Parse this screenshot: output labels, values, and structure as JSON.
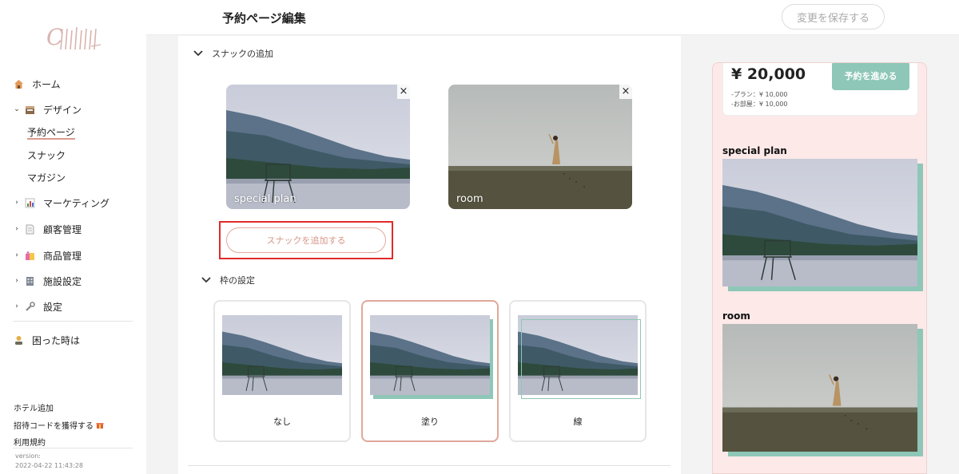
{
  "header": {
    "title": "予約ページ編集",
    "save_label": "変更を保存する"
  },
  "sidebar": {
    "items": [
      {
        "label": "ホーム",
        "icon": "house-icon"
      },
      {
        "label": "デザイン",
        "icon": "design-icon",
        "expanded": true
      },
      {
        "label": "マーケティング",
        "icon": "chart-icon"
      },
      {
        "label": "顧客管理",
        "icon": "document-icon"
      },
      {
        "label": "商品管理",
        "icon": "shopping-bag-icon"
      },
      {
        "label": "施設設定",
        "icon": "building-icon"
      },
      {
        "label": "設定",
        "icon": "wrench-icon"
      }
    ],
    "sub_items": [
      {
        "label": "予約ページ",
        "active": true
      },
      {
        "label": "スナック"
      },
      {
        "label": "マガジン"
      }
    ],
    "help": "困った時は",
    "footer_links": [
      "ホテル追加",
      "招待コードを獲得する",
      "利用規約"
    ],
    "version_label": "version:",
    "version_date": "2022-04-22 11:43:28"
  },
  "snack_section": {
    "title": "スナックの追加",
    "cards": [
      {
        "label": "special plan"
      },
      {
        "label": "room"
      }
    ],
    "add_label": "スナックを追加する"
  },
  "frame_section": {
    "title": "枠の設定",
    "options": [
      {
        "label": "なし"
      },
      {
        "label": "塗り",
        "selected": true
      },
      {
        "label": "線"
      }
    ]
  },
  "preview": {
    "price": "¥ 20,000",
    "plan_line": "-プラン：¥ 10,000",
    "room_line": "-お部屋：¥ 10,000",
    "reserve_label": "予約を進める",
    "sections": [
      {
        "title": "special plan"
      },
      {
        "title": "room"
      }
    ]
  },
  "colors": {
    "accent": "#8ec7b7",
    "pink": "#fce9e8",
    "highlight": "#e02a2a",
    "coral": "#d69888"
  }
}
